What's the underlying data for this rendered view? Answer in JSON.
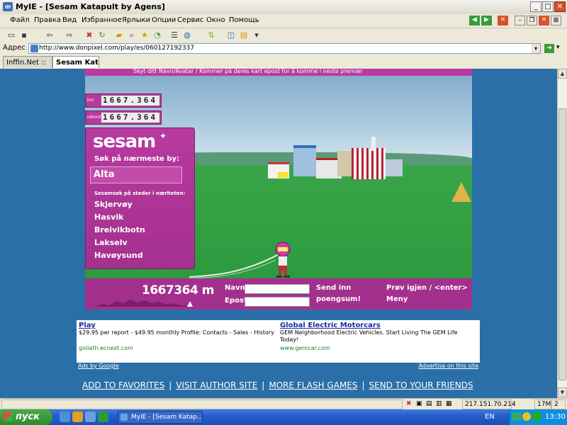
{
  "window": {
    "title": "MyIE - [Sesam Katapult by Agens]"
  },
  "menubar": [
    "Файл",
    "Правка",
    "Вид",
    "Избранное",
    "Ярлыки",
    "Опции",
    "Сервис",
    "Окно",
    "Помощь"
  ],
  "address": {
    "label": "Адрес",
    "url": "http://www.donpixel.com/play/es/060127192337"
  },
  "tabs": [
    {
      "label": "Inffin.Net ::"
    },
    {
      "label": "Sesam Kata"
    }
  ],
  "game": {
    "hud_text": "Skyt ditt Navn/Avatar / Kommer på deres kart epost for å komme i neste premier",
    "counter_km": {
      "label": "km",
      "value": "1667.364"
    },
    "counter_record": {
      "label": "rekord",
      "value": "1667.364"
    },
    "sesam": {
      "logo": "sesam",
      "subtitle": "Søk på nærmeste by:",
      "search": "Alta",
      "nearby_label": "Sesamsøk på steder i nærheten:",
      "places": [
        "Skjervøy",
        "Hasvik",
        "Breivikbotn",
        "Lakselv",
        "Havøysund"
      ]
    },
    "distance": "1667364 m",
    "form": {
      "name_label": "Navn",
      "email_label": "Epost",
      "submit": [
        "Send inn",
        "poengsum!"
      ],
      "retry": "Prøv igjen / <enter>",
      "menu": "Meny"
    }
  },
  "ads": [
    {
      "title": "Play",
      "text": "$29.95 per report - $49.95 monthly Profile: Contacts - Sales - History",
      "url": "goliath.ecnext.com"
    },
    {
      "title": "Global Electric Motorcars",
      "text": "GEM Neighborhood Electric Vehicles. Start Living The GEM Life Today!",
      "url": "www.gemcar.com"
    }
  ],
  "ads_footer": {
    "left": "Ads by Google",
    "right": "Advertise on this site"
  },
  "bottom_links": [
    "ADD TO FAVORITES",
    "VISIT AUTHOR SITE",
    "MORE FLASH GAMES",
    "SEND TO YOUR FRIENDS"
  ],
  "status": {
    "ip": "217.151.70.214",
    "memory": "17M",
    "count": "2"
  },
  "taskbar": {
    "start": "пуск",
    "task": "MyIE - [Sesam Katap...",
    "lang": "EN",
    "clock": "13:30"
  },
  "colors": {
    "page_bg": "#2a6fa8",
    "game_magenta": "#b8389e",
    "ground_green": "#2e9a3f"
  }
}
